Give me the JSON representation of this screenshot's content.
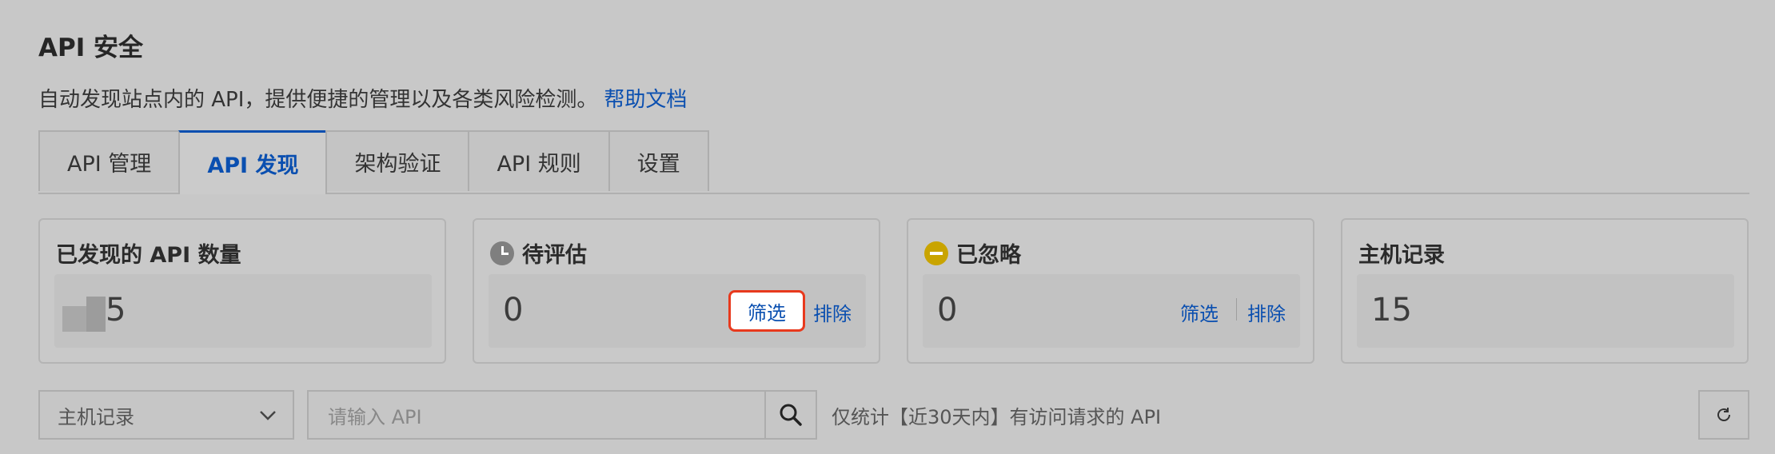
{
  "header": {
    "title": "API 安全",
    "description": "自动发现站点内的 API，提供便捷的管理以及各类风险检测。",
    "help_link": "帮助文档"
  },
  "tabs": [
    {
      "label": "API 管理",
      "active": false
    },
    {
      "label": "API 发现",
      "active": true
    },
    {
      "label": "架构验证",
      "active": false
    },
    {
      "label": "API 规则",
      "active": false
    },
    {
      "label": "设置",
      "active": false
    }
  ],
  "cards": {
    "discovered": {
      "title": "已发现的 API 数量",
      "value": "5"
    },
    "pending": {
      "title": "待评估",
      "icon": "clock-icon",
      "value": "0",
      "filter": "筛选",
      "exclude": "排除"
    },
    "ignored": {
      "title": "已忽略",
      "icon": "minus-circle-icon",
      "value": "0",
      "filter": "筛选",
      "exclude": "排除"
    },
    "hosts": {
      "title": "主机记录",
      "value": "15"
    }
  },
  "toolbar": {
    "select_value": "主机记录",
    "search_placeholder": "请输入 API",
    "hint": "仅统计【近30天内】有访问请求的 API"
  },
  "colors": {
    "accent": "#0a4fb0",
    "highlight_border": "#e8391d",
    "ignored_icon": "#c9a400"
  }
}
